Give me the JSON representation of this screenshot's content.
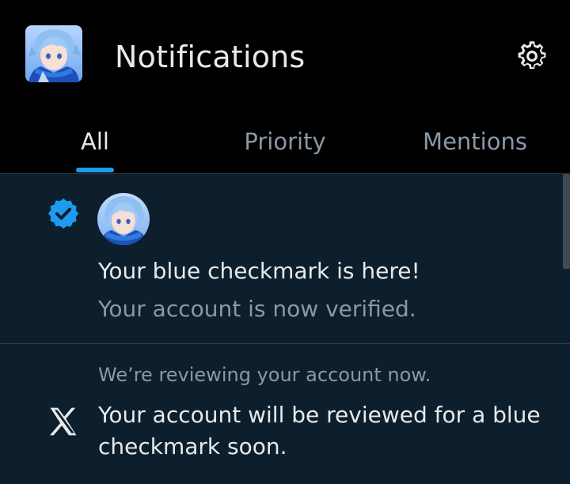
{
  "header": {
    "title": "Notifications",
    "avatar_icon": "profile-avatar",
    "settings_icon": "gear-icon"
  },
  "tabs": [
    {
      "label": "All",
      "active": true
    },
    {
      "label": "Priority",
      "active": false
    },
    {
      "label": "Mentions",
      "active": false
    }
  ],
  "notifications": [
    {
      "icon": "verified-badge-icon",
      "title": "Your blue checkmark is here!",
      "subtitle": "Your account is now verified."
    },
    {
      "icon": "x-logo-icon",
      "pre": "We’re reviewing your account now.",
      "body": "Your account will be reviewed for a blue checkmark soon."
    }
  ],
  "colors": {
    "accent": "#1d9bf0",
    "background": "#000000",
    "list_background": "#0d1f2d",
    "text_primary": "#e7e9ea",
    "text_secondary": "#8b98a5"
  }
}
